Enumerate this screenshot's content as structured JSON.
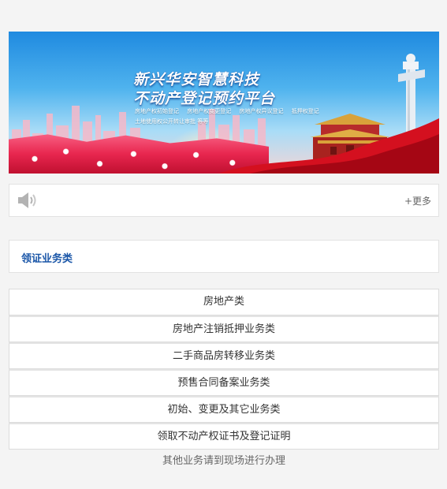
{
  "banner": {
    "title_line1": "新兴华安智慧科技",
    "title_line2": "不动产登记预约平台",
    "sub_items_line1": [
      "房地产权初始登记",
      "房地产权变更登记",
      "房地产权异议登记",
      "抵押权登记"
    ],
    "sub_line2": "土地使用权公开转让审批 等等"
  },
  "notice": {
    "icon": "speaker-icon",
    "more_label": "+更多"
  },
  "section": {
    "title": "领证业务类"
  },
  "menu": {
    "items": [
      "房地产类",
      "房地产注销抵押业务类",
      "二手商品房转移业务类",
      "预售合同备案业务类",
      "初始、变更及其它业务类",
      "领取不动产权证书及登记证明"
    ]
  },
  "footer_note": "其他业务请到现场进行办理",
  "colors": {
    "section_title": "#1a56a8",
    "background": "#f4f4f4"
  }
}
